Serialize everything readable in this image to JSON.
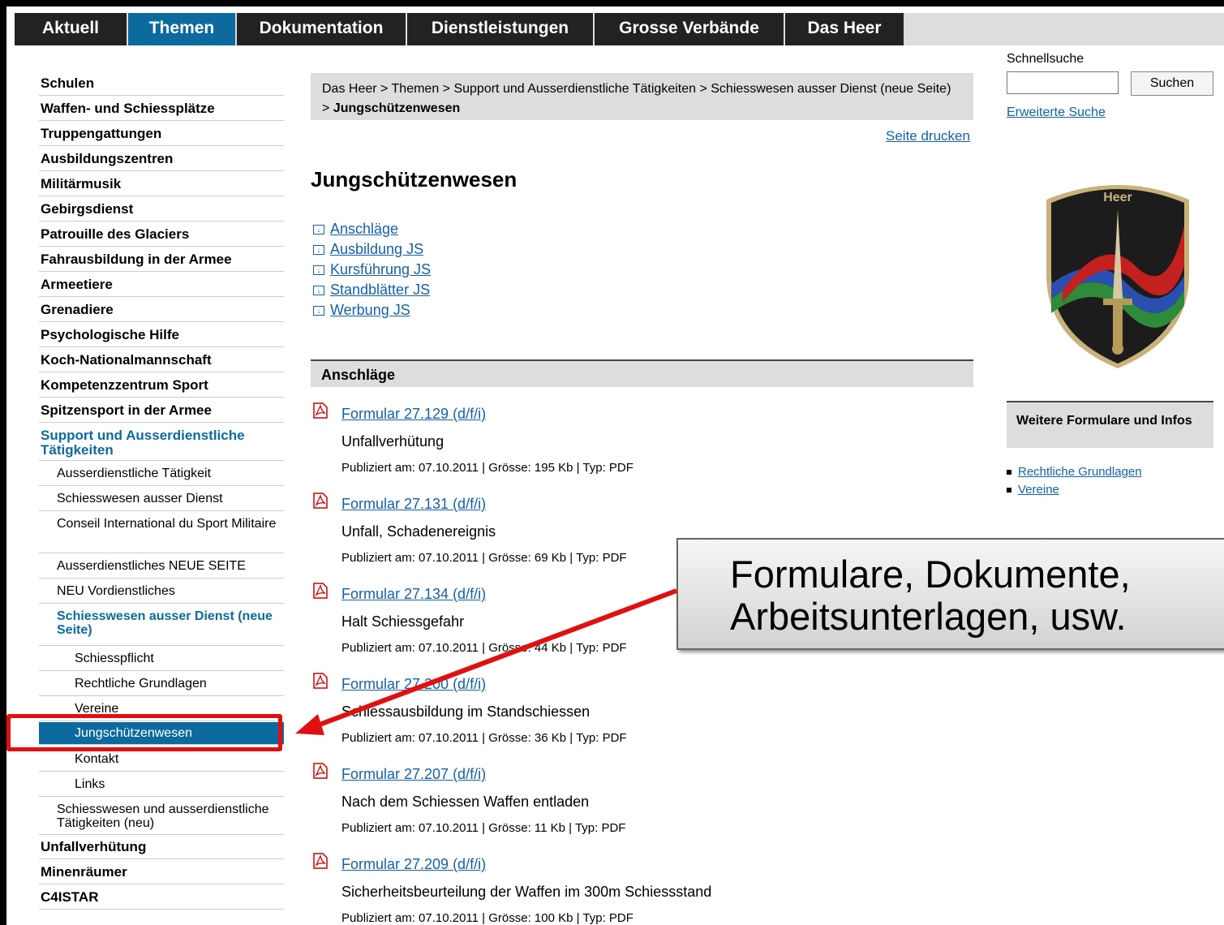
{
  "topnav": [
    "Aktuell",
    "Themen",
    "Dokumentation",
    "Dienstleistungen",
    "Grosse Verbände",
    "Das Heer"
  ],
  "leftnav": [
    {
      "label": "Schulen",
      "level": 1
    },
    {
      "label": "Waffen- und Schiessplätze",
      "level": 1
    },
    {
      "label": "Truppengattungen",
      "level": 1
    },
    {
      "label": "Ausbildungszentren",
      "level": 1
    },
    {
      "label": "Militärmusik",
      "level": 1
    },
    {
      "label": "Gebirgsdienst",
      "level": 1
    },
    {
      "label": "Patrouille des Glaciers",
      "level": 1
    },
    {
      "label": "Fahrausbildung in der Armee",
      "level": 1
    },
    {
      "label": "Armeetiere",
      "level": 1
    },
    {
      "label": "Grenadiere",
      "level": 1
    },
    {
      "label": "Psychologische Hilfe",
      "level": 1
    },
    {
      "label": "Koch-Nationalmannschaft",
      "level": 1
    },
    {
      "label": "Kompetenzzentrum Sport",
      "level": 1
    },
    {
      "label": "Spitzensport in der Armee",
      "level": 1
    },
    {
      "label": "Support und Ausserdienstliche Tätigkeiten",
      "level": 1
    },
    {
      "label": "Ausserdienstliche Tätigkeit",
      "level": 2
    },
    {
      "label": "Schiesswesen ausser Dienst",
      "level": 2
    },
    {
      "label": "Conseil International du Sport Militaire",
      "level": 2
    },
    {
      "label": "Ausserdienstliches NEUE SEITE",
      "level": 2
    },
    {
      "label": "NEU Vordienstliches",
      "level": 2
    },
    {
      "label": "Schiesswesen ausser Dienst (neue Seite)",
      "level": 2
    },
    {
      "label": "Schiesspflicht",
      "level": 3
    },
    {
      "label": "Rechtliche Grundlagen",
      "level": 3
    },
    {
      "label": "Vereine",
      "level": 3
    },
    {
      "label": "Jungschützenwesen",
      "level": 3
    },
    {
      "label": "Kontakt",
      "level": 3
    },
    {
      "label": "Links",
      "level": 3
    },
    {
      "label": "Schiesswesen und ausserdienstliche Tätigkeiten (neu)",
      "level": 2
    },
    {
      "label": "Unfallverhütung",
      "level": 1
    },
    {
      "label": "Minenräumer",
      "level": 1
    },
    {
      "label": "C4ISTAR",
      "level": 1
    }
  ],
  "breadcrumb": {
    "path": "Das Heer > Themen > Support und Ausserdienstliche Tätigkeiten > Schiesswesen ausser Dienst (neue Seite) > ",
    "current": "Jungschützenwesen"
  },
  "print_label": "Seite drucken",
  "page_title": "Jungschützenwesen",
  "toc": [
    "Anschläge",
    "Ausbildung JS",
    "Kursführung JS",
    "Standblätter JS",
    "Werbung JS"
  ],
  "section_title": "Anschläge",
  "documents": [
    {
      "title": "Formular 27.129 (d/f/i)",
      "desc": "Unfallverhütung",
      "meta": "Publiziert am: 07.10.2011 | Grösse: 195 Kb | Typ: PDF"
    },
    {
      "title": "Formular 27.131 (d/f/i)",
      "desc": "Unfall, Schadenereignis",
      "meta": "Publiziert am: 07.10.2011 | Grösse: 69 Kb | Typ: PDF"
    },
    {
      "title": "Formular 27.134 (d/f/i)",
      "desc": "Halt Schiessgefahr",
      "meta": "Publiziert am: 07.10.2011 | Grösse: 44 Kb | Typ: PDF"
    },
    {
      "title": "Formular 27.200 (d/f/i)",
      "desc": "Schiessausbildung im Standschiessen",
      "meta": "Publiziert am: 07.10.2011 | Grösse: 36 Kb | Typ: PDF"
    },
    {
      "title": "Formular 27.207 (d/f/i)",
      "desc": "Nach dem Schiessen Waffen entladen",
      "meta": "Publiziert am: 07.10.2011 | Grösse: 11 Kb | Typ: PDF"
    },
    {
      "title": "Formular 27.209 (d/f/i)",
      "desc": "Sicherheitsbeurteilung der Waffen im 300m Schiessstand",
      "meta": "Publiziert am: 07.10.2011 | Grösse: 100 Kb | Typ: PDF"
    }
  ],
  "search": {
    "label": "Schnellsuche",
    "button": "Suchen",
    "advanced": "Erweiterte Suche"
  },
  "emblem_text": "Heer",
  "forms_box": {
    "title": "Weitere Formulare und Infos",
    "links": [
      "Rechtliche Grundlagen",
      "Vereine"
    ]
  },
  "callout": {
    "line1": "Formulare, Dokumente,",
    "line2": "Arbeitsunterlagen, usw."
  },
  "colors": {
    "accent": "#0d6a9e",
    "link": "#1560a8",
    "highlight": "#e01010"
  }
}
